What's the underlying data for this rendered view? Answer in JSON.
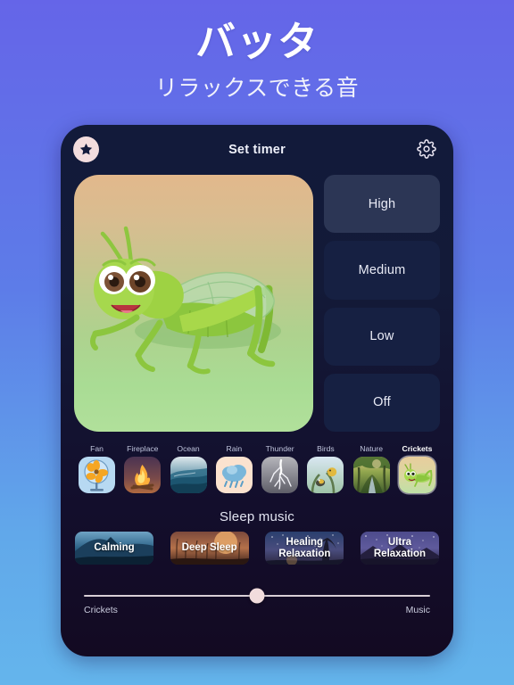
{
  "hero": {
    "title": "バッタ",
    "subtitle": "リラックスできる音"
  },
  "card": {
    "header": {
      "title": "Set timer",
      "star_icon": "star-badge-icon",
      "gear_icon": "gear-icon"
    },
    "artwork": {
      "name": "grasshopper-illustration",
      "alt": "Cartoon green grasshopper on gradient background"
    },
    "timer_options": [
      {
        "label": "High",
        "selected": true
      },
      {
        "label": "Medium",
        "selected": false
      },
      {
        "label": "Low",
        "selected": false
      },
      {
        "label": "Off",
        "selected": false
      }
    ],
    "sounds": [
      {
        "label": "Fan",
        "icon": "fan-icon",
        "active": false
      },
      {
        "label": "Fireplace",
        "icon": "fireplace-icon",
        "active": false
      },
      {
        "label": "Ocean",
        "icon": "ocean-icon",
        "active": false
      },
      {
        "label": "Rain",
        "icon": "rain-icon",
        "active": false
      },
      {
        "label": "Thunder",
        "icon": "thunder-icon",
        "active": false
      },
      {
        "label": "Birds",
        "icon": "birds-icon",
        "active": false
      },
      {
        "label": "Nature",
        "icon": "nature-icon",
        "active": false
      },
      {
        "label": "Crickets",
        "icon": "cricket-icon",
        "active": true
      }
    ],
    "sleep_music": {
      "title": "Sleep music",
      "items": [
        {
          "label": "Calming",
          "art": "mountain-night"
        },
        {
          "label": "Deep Sleep",
          "art": "moonrise"
        },
        {
          "label": "Healing\nRelaxation",
          "art": "palm-stars"
        },
        {
          "label": "Ultra\nRelaxation",
          "art": "purple-stars"
        }
      ]
    },
    "mix_slider": {
      "left_label": "Crickets",
      "right_label": "Music",
      "value": 50
    }
  },
  "colors": {
    "bg_top": "#6565e8",
    "bg_bottom": "#64b5ec",
    "card_top": "#121a3a",
    "card_bottom": "#130a22",
    "selected_btn": "#2c3655",
    "btn": "#162042",
    "text": "#e9ebf6"
  }
}
